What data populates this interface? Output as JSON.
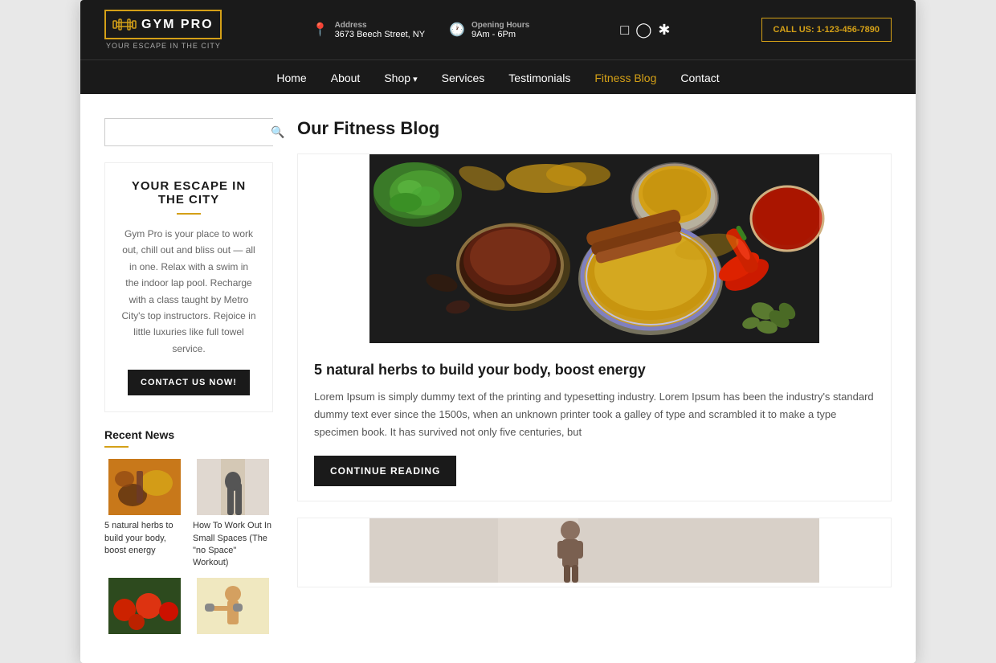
{
  "browser": {
    "background": "#e8e8e8"
  },
  "header": {
    "logo_text": "GYM PRO",
    "logo_tagline": "YOUR ESCAPE IN THE CITY",
    "address_label": "Address",
    "address_value": "3673 Beech Street, NY",
    "hours_label": "Opening Hours",
    "hours_value": "9Am - 6Pm",
    "call_btn": "CALL US: 1-123-456-7890"
  },
  "nav": {
    "items": [
      {
        "label": "Home",
        "active": false,
        "has_arrow": false
      },
      {
        "label": "About",
        "active": false,
        "has_arrow": false
      },
      {
        "label": "Shop",
        "active": false,
        "has_arrow": true
      },
      {
        "label": "Services",
        "active": false,
        "has_arrow": false
      },
      {
        "label": "Testimonials",
        "active": false,
        "has_arrow": false
      },
      {
        "label": "Fitness Blog",
        "active": true,
        "has_arrow": false
      },
      {
        "label": "Contact",
        "active": false,
        "has_arrow": false
      }
    ]
  },
  "sidebar": {
    "search_placeholder": "",
    "widget": {
      "title": "YOUR ESCAPE IN THE CITY",
      "text": "Gym Pro is your place to work out, chill out and bliss out — all in one. Relax with a swim in the indoor lap pool. Recharge with a class taught by Metro City's top instructors. Rejoice in little luxuries like full towel service.",
      "cta": "CONTACT US NOW!"
    },
    "recent_news": {
      "title": "Recent News",
      "items": [
        {
          "caption": "5 natural herbs to build your body, boost energy"
        },
        {
          "caption": "How To Work Out In Small Spaces (The \"no Space\" Workout)"
        },
        {
          "caption": ""
        },
        {
          "caption": ""
        }
      ]
    }
  },
  "blog": {
    "title": "Our Fitness Blog",
    "posts": [
      {
        "heading": "5 natural herbs to build your body, boost energy",
        "excerpt": "Lorem Ipsum is simply dummy text of the printing and typesetting industry. Lorem Ipsum has been the industry's standard dummy text ever since the 1500s, when an unknown printer took a galley of type and scrambled it to make a type specimen book. It has survived not only five centuries, but",
        "cta": "CONTINUE READING"
      }
    ]
  }
}
